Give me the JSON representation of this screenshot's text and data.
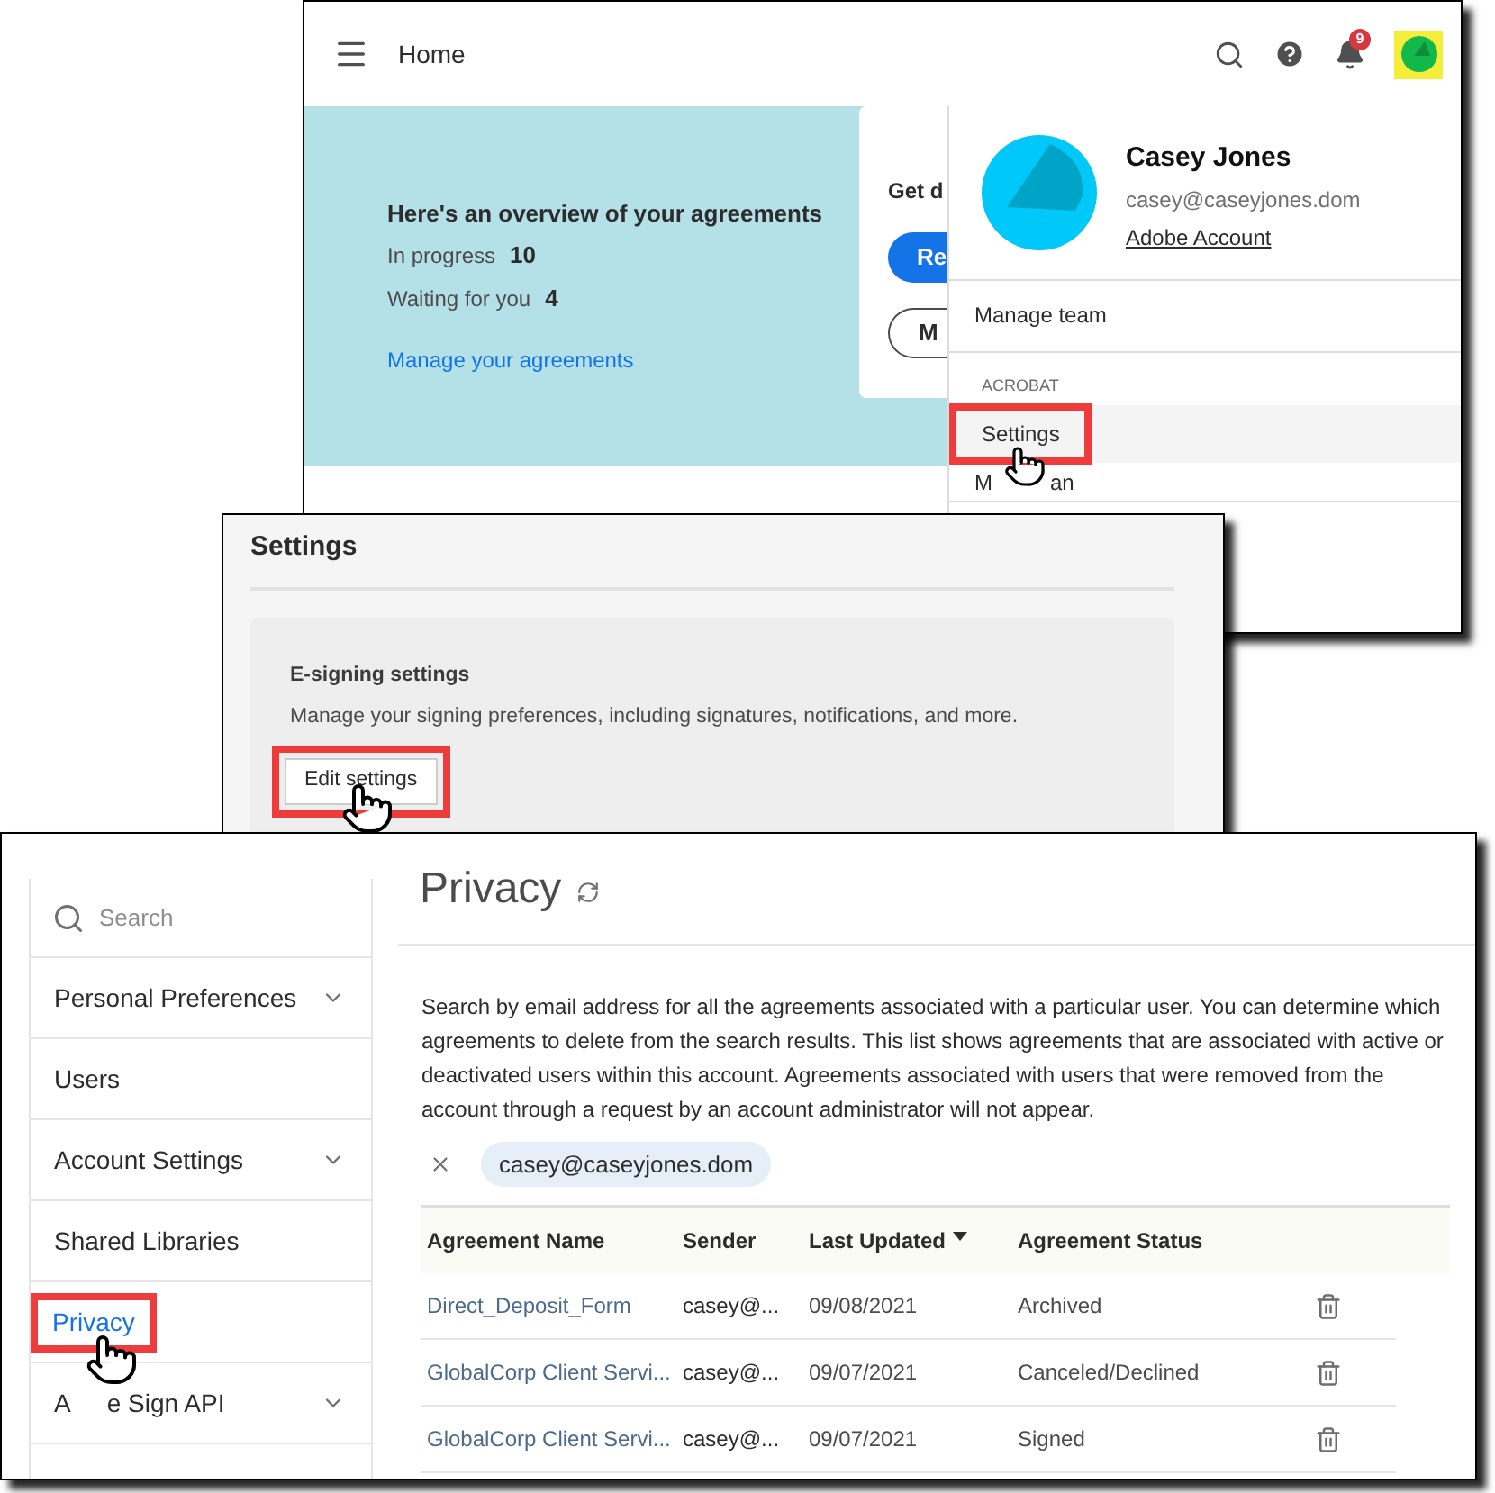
{
  "home_window": {
    "menu_title": "Home",
    "notification_count": "9",
    "avatar_highlighted": true,
    "overview": {
      "title": "Here's an overview of your agreements",
      "stats": [
        {
          "label": "In progress",
          "value": "10"
        },
        {
          "label": "Waiting for you",
          "value": "4"
        }
      ],
      "link": "Manage your agreements"
    },
    "card": {
      "title": "Get d",
      "buttons": [
        {
          "label": "Re",
          "kind": "primary"
        },
        {
          "label": "M",
          "kind": "outline"
        }
      ]
    },
    "account_menu": {
      "name": "Casey Jones",
      "email": "casey@caseyjones.dom",
      "account_link": "Adobe Account",
      "items": [
        {
          "kind": "item",
          "label": "Manage team",
          "selected": false,
          "callout": false
        },
        {
          "kind": "section",
          "label": "ACROBAT"
        },
        {
          "kind": "item",
          "label": "Settings",
          "selected": true,
          "callout": true
        },
        {
          "kind": "covered",
          "label_start": "M",
          "label_end": "an"
        }
      ]
    }
  },
  "settings_window": {
    "title": "Settings",
    "section": {
      "title": "E-signing settings",
      "description": "Manage your signing preferences, including signatures, notifications, and more.",
      "button": "Edit settings",
      "callout": true
    }
  },
  "privacy_window": {
    "sidebar": {
      "search_placeholder": "Search",
      "items": [
        {
          "kind": "item",
          "label": "Personal Preferences",
          "expandable": true,
          "selected": false,
          "callout": false
        },
        {
          "kind": "item",
          "label": "Users",
          "expandable": false,
          "selected": false,
          "callout": false
        },
        {
          "kind": "item",
          "label": "Account Settings",
          "expandable": true,
          "selected": false,
          "callout": false
        },
        {
          "kind": "item",
          "label": "Shared Libraries",
          "expandable": false,
          "selected": false,
          "callout": false
        },
        {
          "kind": "item",
          "label": "Privacy",
          "expandable": false,
          "selected": true,
          "callout": true
        },
        {
          "kind": "covered",
          "label_start": "A",
          "label_end": "e Sign API",
          "expandable": true
        }
      ]
    },
    "title": "Privacy",
    "description": "Search by email address for all the agreements associated with a particular user. You can determine which agreements to delete from the search results. This list shows agreements that are associated with active or deactivated users within this account. Agreements associated with users that were removed from the account through a request by an account administrator will not appear.",
    "filter_chip": "casey@caseyjones.dom",
    "table": {
      "columns": [
        {
          "label": "Agreement Name",
          "sorted": false
        },
        {
          "label": "Sender",
          "sorted": false
        },
        {
          "label": "Last Updated",
          "sorted": true
        },
        {
          "label": "Agreement Status",
          "sorted": false
        }
      ],
      "rows": [
        {
          "name": "Direct_Deposit_Form",
          "sender": "casey@...",
          "updated": "09/08/2021",
          "status": "Archived"
        },
        {
          "name": "GlobalCorp Client Servi...",
          "sender": "casey@...",
          "updated": "09/07/2021",
          "status": "Canceled/Declined"
        },
        {
          "name": "GlobalCorp Client Servi...",
          "sender": "casey@...",
          "updated": "09/07/2021",
          "status": "Signed"
        }
      ]
    }
  }
}
